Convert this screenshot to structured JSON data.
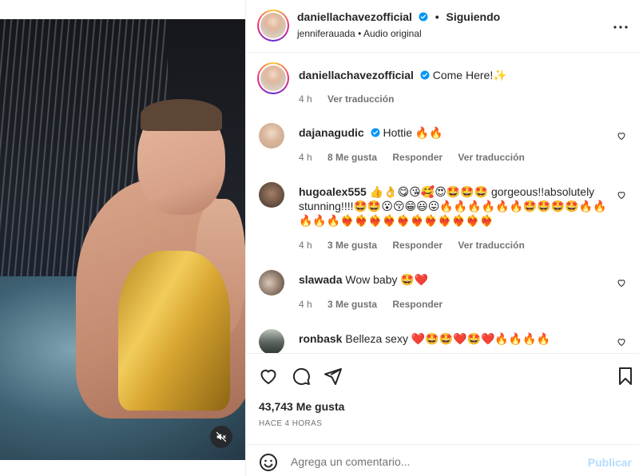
{
  "post": {
    "author": "daniellachavezofficial",
    "follow_status": "Siguiendo",
    "audio_user": "jenniferauada",
    "audio_label": "Audio original",
    "caption": "Come Here!✨",
    "caption_time": "4 h",
    "translate": "Ver traducción"
  },
  "comments": [
    {
      "user": "dajanagudic",
      "text": "Hottie 🔥🔥",
      "time": "4 h",
      "likes": "8 Me gusta",
      "reply": "Responder",
      "translate": "Ver traducción"
    },
    {
      "user": "hugoalex555",
      "text": "👍👌😋😘🥰😍🤩🤩🤩 gorgeous!!absolutely stunning!!!!🤩🤩😮😚😁😃😛🔥🔥🔥🔥🔥🔥🤩🤩🤩🤩🔥🔥🔥🔥🔥❤️‍🔥❤️‍🔥❤️‍🔥❤️‍🔥❤️‍🔥❤️‍🔥❤️‍🔥❤️‍🔥❤️‍🔥❤️‍🔥❤️‍🔥",
      "time": "4 h",
      "likes": "3 Me gusta",
      "reply": "Responder",
      "translate": "Ver traducción"
    },
    {
      "user": "slawada",
      "text": "Wow baby 🤩❤️",
      "time": "4 h",
      "likes": "3 Me gusta",
      "reply": "Responder"
    },
    {
      "user": "ronbask",
      "text": "Belleza sexy ❤️🤩🤩❤️🤩❤️🔥🔥🔥🔥"
    }
  ],
  "actions": {
    "like_count": "43,743 Me gusta",
    "timestamp": "HACE 4 HORAS"
  },
  "composer": {
    "placeholder": "Agrega un comentario...",
    "publish_label": "Publicar"
  },
  "icons": {
    "more": "more-horizontal-icon",
    "verified": "verified-badge-icon",
    "mute": "speaker-muted-icon",
    "like": "heart-icon",
    "comment": "comment-bubble-icon",
    "share": "paper-plane-icon",
    "save": "bookmark-icon",
    "emoji": "smiley-face-icon"
  },
  "colors": {
    "verified_blue": "#0095f6",
    "publish_disabled": "#b3dbff",
    "muted_text": "#737373"
  }
}
